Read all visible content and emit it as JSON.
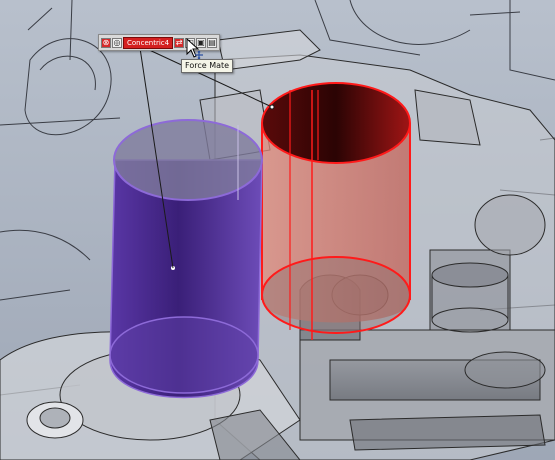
{
  "mate_popup": {
    "mate_name": "Concentric4",
    "buttons": [
      {
        "icon": "close-icon",
        "glyph": "⊗"
      },
      {
        "icon": "clear-selection-icon",
        "glyph": "◎"
      },
      {
        "icon": "flip-alignment-icon",
        "glyph": "⇄"
      },
      {
        "icon": "lock-rotation-icon",
        "glyph": "◧"
      },
      {
        "icon": "force-mate-icon",
        "glyph": "▣"
      },
      {
        "icon": "options-icon",
        "glyph": "▤"
      }
    ]
  },
  "tooltip": {
    "text": "Force Mate"
  },
  "colors": {
    "background": "#aab3c1",
    "selected_face": "#4a2a8c",
    "error_face": "#c42222",
    "error_edge": "#ff1a1a",
    "part_edge": "#2b2b2b"
  }
}
